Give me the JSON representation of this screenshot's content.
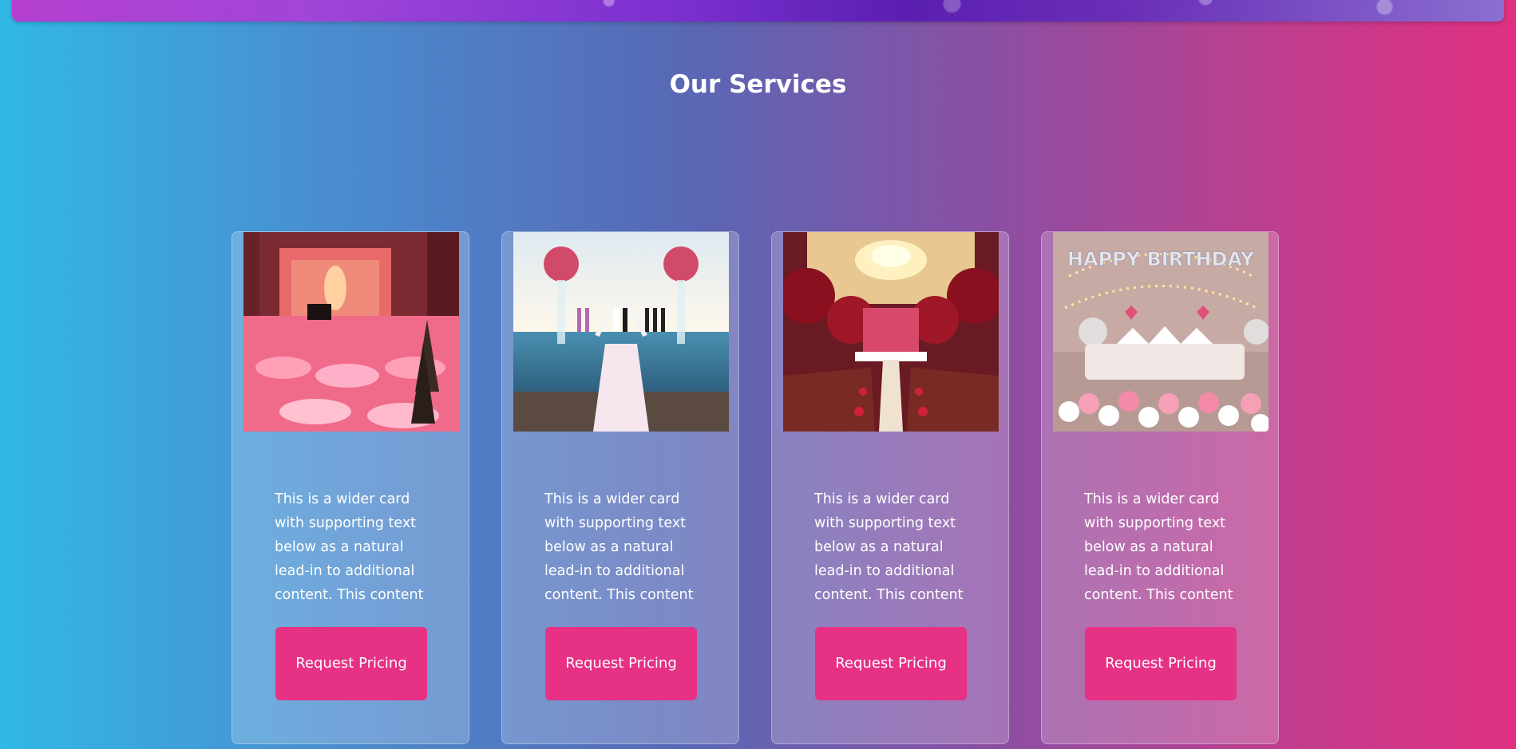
{
  "section": {
    "title": "Our Services"
  },
  "cards": [
    {
      "text": "This is a wider card with supporting text below as a natural lead-in to additional content. This content is a little bit longer",
      "button_label": "Request Pricing"
    },
    {
      "text": "This is a wider card with supporting text below as a natural lead-in to additional content. This content is a little bit longer",
      "button_label": "Request Pricing"
    },
    {
      "text": "This is a wider card with supporting text below as a natural lead-in to additional content. This content is a little bit longer",
      "button_label": "Request Pricing"
    },
    {
      "text": "This is a wider card with supporting text below as a natural lead-in to additional content. This content is a little bit longer",
      "button_label": "Request Pricing"
    }
  ],
  "birthday_sign": "HAPPY BIRTHDAY",
  "colors": {
    "background_left": "#31b8e6",
    "background_right": "#e03082",
    "button": "#e63185",
    "text": "#ffffff"
  }
}
